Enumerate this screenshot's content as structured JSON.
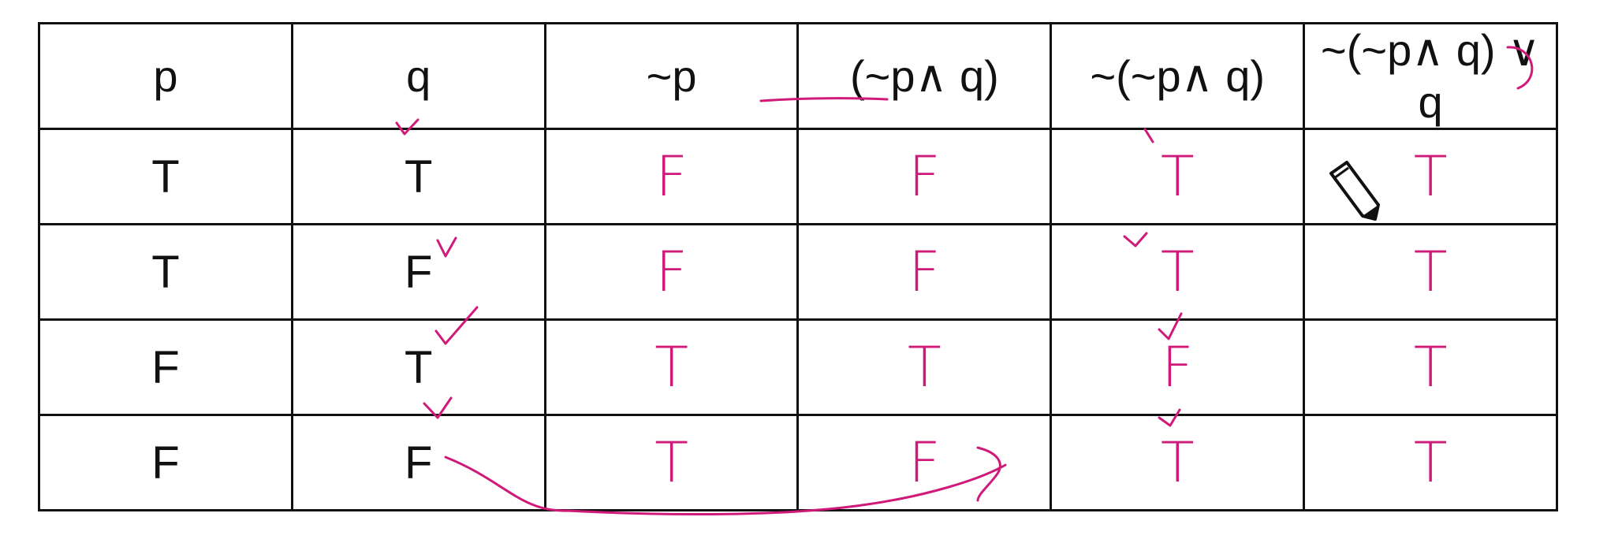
{
  "table": {
    "headers": [
      "p",
      "q",
      "~p",
      "(~p∧ q)",
      "~(~p∧ q)",
      "~(~p∧ q) ∨ q"
    ],
    "rows": [
      {
        "p": "T",
        "q": "T",
        "not_p": "F",
        "not_p_and_q": "F",
        "not_of_not_p_and_q": "T",
        "result": "T"
      },
      {
        "p": "T",
        "q": "F",
        "not_p": "F",
        "not_p_and_q": "F",
        "not_of_not_p_and_q": "T",
        "result": "T"
      },
      {
        "p": "F",
        "q": "T",
        "not_p": "T",
        "not_p_and_q": "T",
        "not_of_not_p_and_q": "F",
        "result": "T"
      },
      {
        "p": "F",
        "q": "F",
        "not_p": "T",
        "not_p_and_q": "F",
        "not_of_not_p_and_q": "T",
        "result": "T"
      }
    ]
  },
  "colors": {
    "ink": "#d01a7a",
    "grid": "#111111"
  },
  "icons": {
    "cursor": "pencil-icon"
  }
}
